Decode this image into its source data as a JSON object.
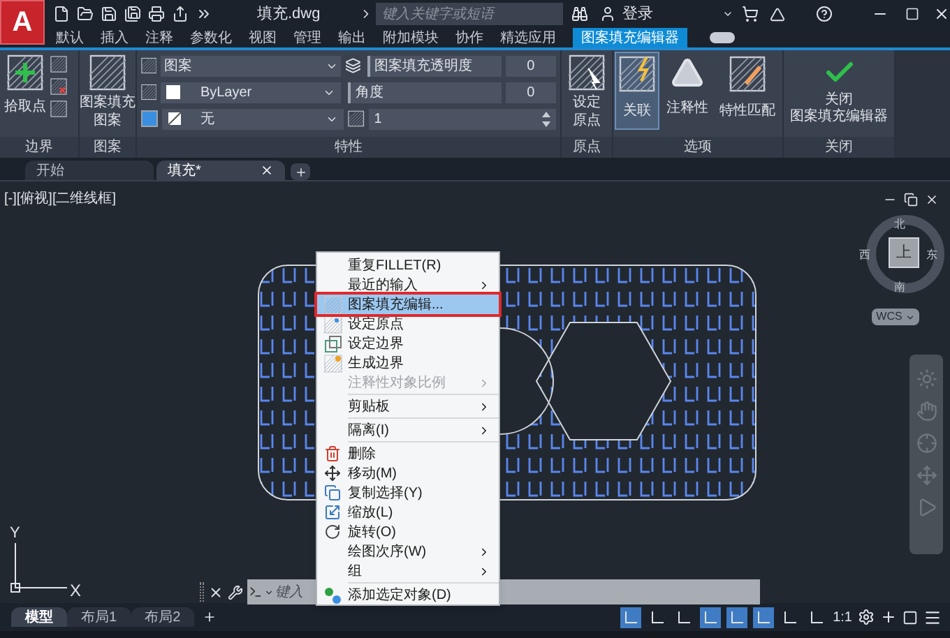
{
  "logo": {
    "letter": "A"
  },
  "title_bar": {
    "file_name": "填充.dwg",
    "search": {
      "placeholder": "键入关键字或短语"
    },
    "login": "登录"
  },
  "menu_tabs": [
    {
      "label": "默认",
      "selected": false
    },
    {
      "label": "插入",
      "selected": false
    },
    {
      "label": "注释",
      "selected": false
    },
    {
      "label": "参数化",
      "selected": false
    },
    {
      "label": "视图",
      "selected": false
    },
    {
      "label": "管理",
      "selected": false
    },
    {
      "label": "输出",
      "selected": false
    },
    {
      "label": "附加模块",
      "selected": false
    },
    {
      "label": "协作",
      "selected": false
    },
    {
      "label": "精选应用",
      "selected": false
    },
    {
      "label": "图案填充编辑器",
      "selected": true
    }
  ],
  "ribbon": {
    "boundary": {
      "pick_points": "拾取点",
      "footer": "边界"
    },
    "pattern": {
      "button": [
        "图案填充",
        "图案"
      ],
      "footer": "图案"
    },
    "properties": {
      "pattern_type": "图案",
      "layer_option": "ByLayer",
      "background_option": "无",
      "transparency_label": "图案填充透明度",
      "transparency": "0",
      "angle_label": "角度",
      "angle": "0",
      "scale": "1",
      "footer": "特性"
    },
    "origin": {
      "button": [
        "设定",
        "原点"
      ],
      "footer": "原点"
    },
    "options": {
      "buttons": [
        {
          "label": "关联",
          "selected": true
        },
        {
          "label": "注释性",
          "selected": false
        },
        {
          "label": "特性匹配",
          "selected": false
        }
      ],
      "footer": "选项"
    },
    "close": {
      "button": [
        "关闭",
        "图案填充编辑器"
      ],
      "footer": "关闭"
    }
  },
  "doc_tabs": [
    {
      "label": "开始",
      "selected": false
    },
    {
      "label": "填充*",
      "selected": true
    }
  ],
  "viewport_label": "[-][俯视][二维线框]",
  "view_cube": {
    "north": "北",
    "south": "南",
    "east": "东",
    "west": "西",
    "face": "上",
    "ucs": "WCS"
  },
  "context_menu": {
    "groups": [
      [
        {
          "label": "重复FILLET(R)",
          "selected": false,
          "disabled": false,
          "submenu": false
        },
        {
          "label": "最近的输入",
          "selected": false,
          "disabled": false,
          "submenu": true
        },
        {
          "label": "图案填充编辑...",
          "selected": true,
          "disabled": false,
          "submenu": false
        },
        {
          "label": "设定原点",
          "selected": false,
          "disabled": false,
          "submenu": false
        },
        {
          "label": "设定边界",
          "selected": false,
          "disabled": false,
          "submenu": false
        },
        {
          "label": "生成边界",
          "selected": false,
          "disabled": false,
          "submenu": false
        },
        {
          "label": "注释性对象比例",
          "selected": false,
          "disabled": true,
          "submenu": true
        }
      ],
      [
        {
          "label": "剪贴板",
          "selected": false,
          "disabled": false,
          "submenu": true
        }
      ],
      [
        {
          "label": "隔离(I)",
          "selected": false,
          "disabled": false,
          "submenu": true
        }
      ],
      [
        {
          "label": "删除",
          "selected": false,
          "disabled": false,
          "submenu": false
        },
        {
          "label": "移动(M)",
          "selected": false,
          "disabled": false,
          "submenu": false
        },
        {
          "label": "复制选择(Y)",
          "selected": false,
          "disabled": false,
          "submenu": false
        },
        {
          "label": "缩放(L)",
          "selected": false,
          "disabled": false,
          "submenu": false
        },
        {
          "label": "旋转(O)",
          "selected": false,
          "disabled": false,
          "submenu": false
        },
        {
          "label": "绘图次序(W)",
          "selected": false,
          "disabled": false,
          "submenu": true
        },
        {
          "label": "组",
          "selected": false,
          "disabled": false,
          "submenu": true
        }
      ],
      [
        {
          "label": "添加选定对象(D)",
          "selected": false,
          "disabled": false,
          "submenu": false
        }
      ]
    ]
  },
  "ucs_icon": {
    "x": "X",
    "y": "Y"
  },
  "command_line": {
    "placeholder": "键入"
  },
  "layout_tabs": [
    {
      "label": "模型",
      "selected": true
    },
    {
      "label": "布局1",
      "selected": false
    },
    {
      "label": "布局2",
      "selected": false
    }
  ],
  "status_bar": {
    "toggles": [
      {
        "on": true
      },
      {
        "on": false
      },
      {
        "on": false
      },
      {
        "on": true
      },
      {
        "on": true
      },
      {
        "on": true
      },
      {
        "on": false
      },
      {
        "on": false
      }
    ],
    "scale": "1:1"
  }
}
